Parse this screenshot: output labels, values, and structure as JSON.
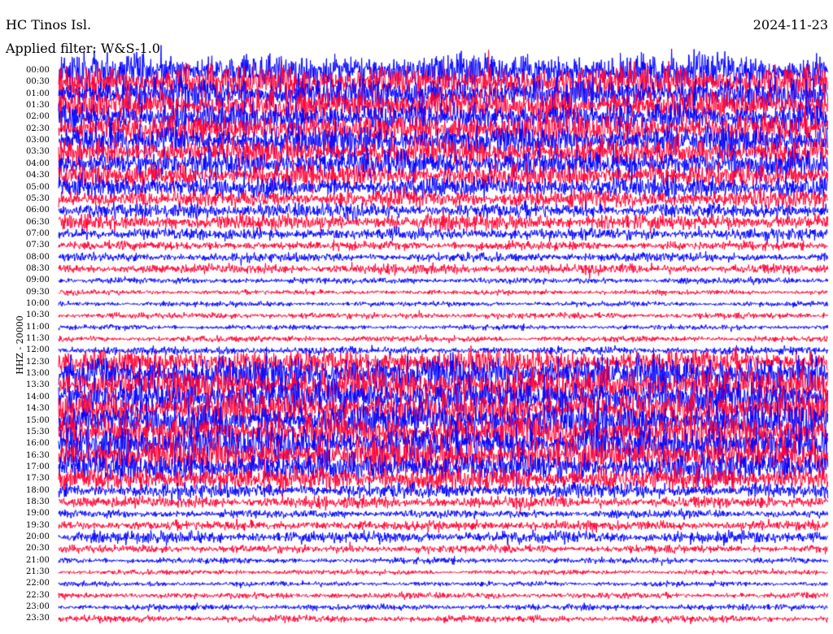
{
  "header": {
    "station": "HC Tinos Isl.",
    "date": "2024-11-23",
    "filter_note": "Applied filter: W&S-1.0"
  },
  "axis": {
    "ylabel": "HHZ - 20000"
  },
  "colors": {
    "trace_a": "#0000ff",
    "trace_b": "#ff0033",
    "background": "#ffffff",
    "text": "#000000"
  },
  "chart_data": {
    "type": "helicorder",
    "title": "HC Tinos Isl.",
    "date": "2024-11-23",
    "channel": "HHZ - 20000",
    "row_labels": [
      "00:00",
      "00:30",
      "01:00",
      "01:30",
      "02:00",
      "02:30",
      "03:00",
      "03:30",
      "04:00",
      "04:30",
      "05:00",
      "05:30",
      "06:00",
      "06:30",
      "07:00",
      "07:30",
      "08:00",
      "08:30",
      "09:00",
      "09:30",
      "10:00",
      "10:30",
      "11:00",
      "11:30",
      "12:00",
      "12:30",
      "13:00",
      "13:30",
      "14:00",
      "14:30",
      "15:00",
      "15:30",
      "16:00",
      "16:30",
      "17:00",
      "17:30",
      "18:00",
      "18:30",
      "19:00",
      "19:30",
      "20:00",
      "20:30",
      "21:00",
      "21:30",
      "22:00",
      "22:30",
      "23:00",
      "23:30"
    ],
    "row_colors": [
      "blue",
      "red",
      "blue",
      "red",
      "blue",
      "red",
      "blue",
      "red",
      "blue",
      "red",
      "blue",
      "red",
      "blue",
      "red",
      "blue",
      "red",
      "blue",
      "red",
      "blue",
      "red",
      "blue",
      "red",
      "blue",
      "red",
      "blue",
      "red",
      "blue",
      "red",
      "blue",
      "red",
      "blue",
      "red",
      "blue",
      "red",
      "blue",
      "red",
      "blue",
      "red",
      "blue",
      "red",
      "blue",
      "red",
      "blue",
      "red",
      "blue",
      "red",
      "blue",
      "red"
    ],
    "relative_noise_amplitude": [
      3.5,
      3.5,
      3.2,
      3.2,
      3.0,
      3.0,
      3.0,
      2.8,
      2.8,
      2.5,
      2.2,
      1.8,
      1.5,
      1.6,
      1.2,
      0.9,
      0.9,
      1.0,
      0.6,
      0.5,
      0.5,
      0.6,
      0.5,
      0.6,
      0.8,
      2.5,
      3.5,
      3.5,
      3.5,
      3.5,
      3.5,
      3.5,
      3.5,
      3.5,
      3.0,
      2.5,
      1.5,
      1.2,
      0.8,
      1.0,
      1.2,
      0.8,
      0.6,
      0.5,
      0.5,
      0.6,
      0.6,
      0.7
    ]
  }
}
